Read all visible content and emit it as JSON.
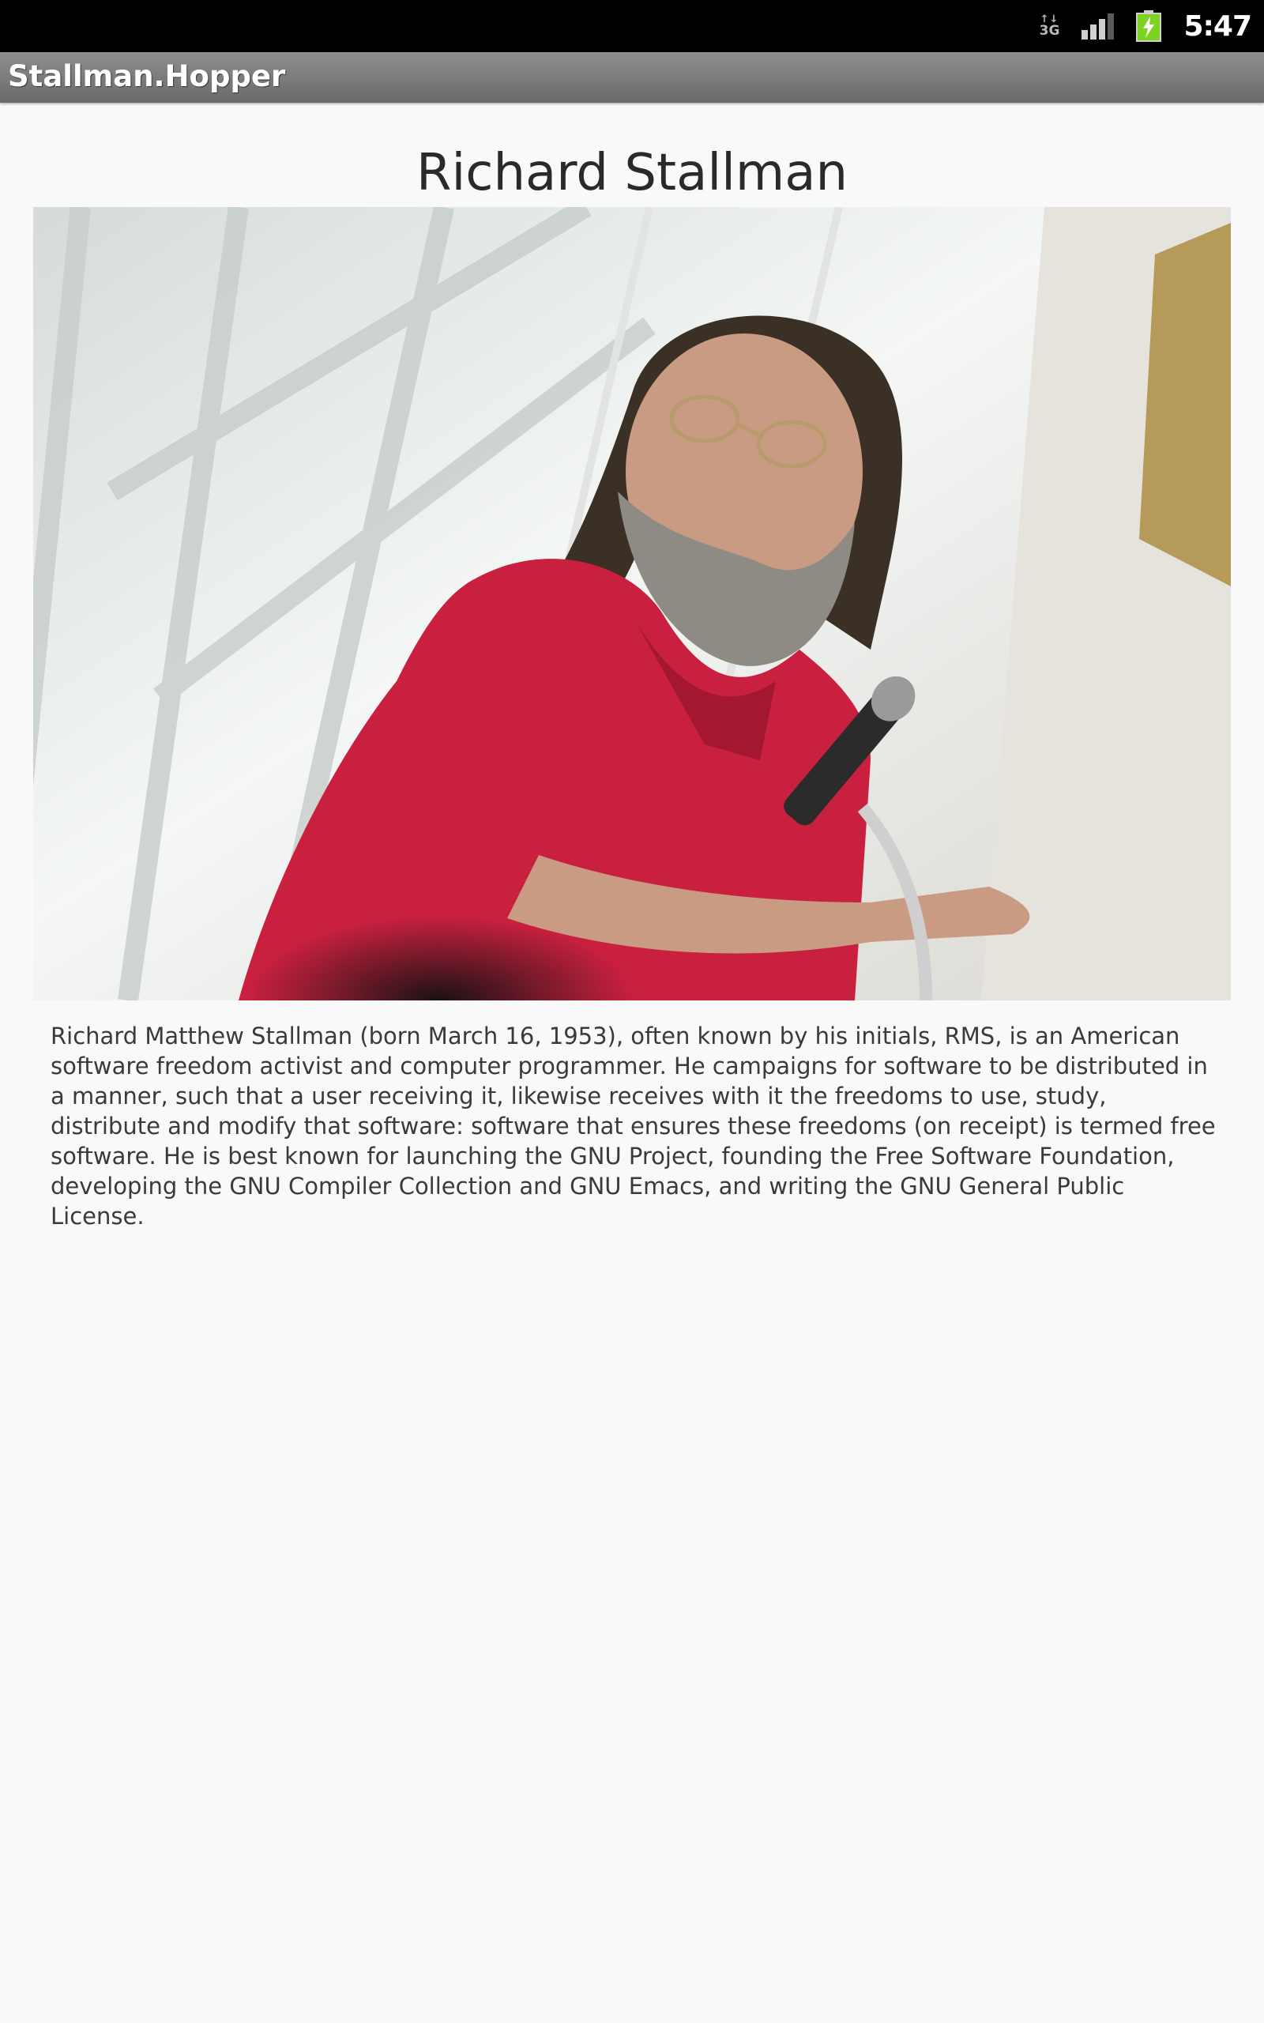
{
  "status_bar": {
    "network_type": "3G",
    "network_arrows": "↑↓",
    "time": "5:47",
    "colors": {
      "background": "#000000",
      "battery": "#7ed321"
    },
    "icons": [
      "network-activity-icon",
      "signal-strength-icon",
      "battery-charging-icon"
    ]
  },
  "app_bar": {
    "title": "Stallman.Hopper"
  },
  "main": {
    "title": "Richard Stallman",
    "image_alt": "Photo of Richard Stallman speaking at a microphone",
    "bio": "Richard Matthew Stallman (born March 16, 1953), often known by his initials, RMS, is an American software freedom activist and computer programmer. He campaigns for software to be distributed in a manner, such that a user receiving it, likewise receives with it the freedoms to use, study, distribute and modify that software: software that ensures these freedoms (on receipt) is termed free software. He is best known for launching the GNU Project, founding the Free Software Foundation, developing the GNU Compiler Collection and GNU Emacs, and writing the GNU General Public License."
  }
}
